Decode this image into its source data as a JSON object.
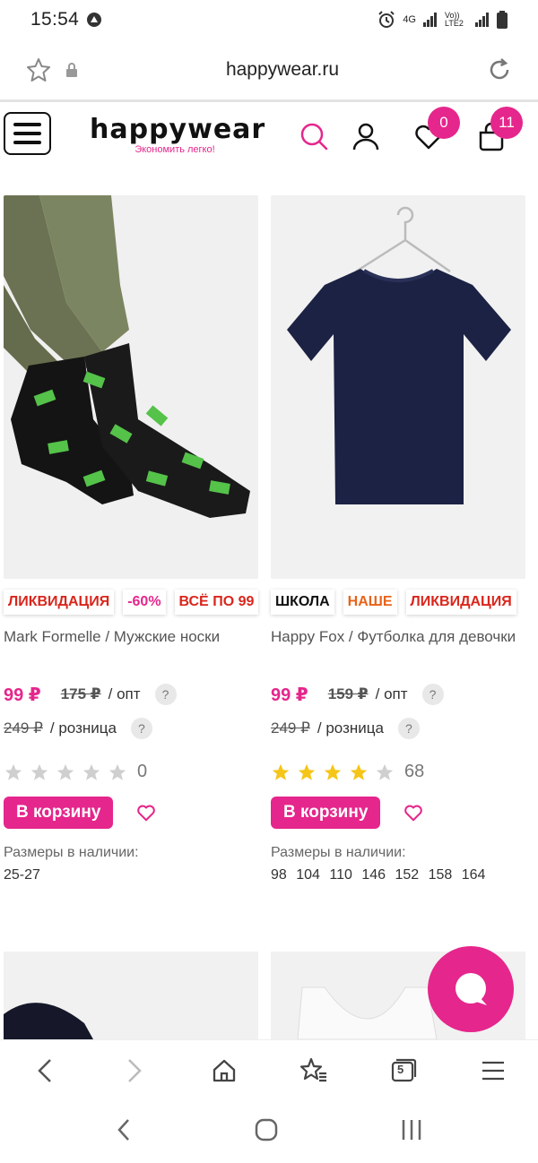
{
  "status_bar": {
    "time": "15:54",
    "network": "4G",
    "volte": "Vo)) LTE2"
  },
  "browser": {
    "url": "happywear.ru",
    "tab_count": "5"
  },
  "site": {
    "logo": "happywear",
    "tagline": "Экономить легко!",
    "favorites_count": "0",
    "cart_count": "11",
    "accent_color": "#e5268c"
  },
  "products": [
    {
      "tags": [
        {
          "label": "ЛИКВИДАЦИЯ",
          "color": "#d9261c"
        },
        {
          "label": "-60%",
          "color": "#e5268c"
        },
        {
          "label": "ВСЁ ПО 99",
          "color": "#d9261c"
        }
      ],
      "title": "Mark Formelle / Мужские носки",
      "price": "99 ₽",
      "old_wholesale": "175 ₽",
      "wholesale_label": "/ опт",
      "retail_price": "249 ₽",
      "retail_label": "/ розница",
      "rating": 0,
      "reviews": "0",
      "cart_label": "В корзину",
      "sizes_label": "Размеры в наличии:",
      "sizes": "25-27"
    },
    {
      "tags": [
        {
          "label": "ШКОЛА",
          "color": "#111111"
        },
        {
          "label": "НАШЕ",
          "color": "#e8631a"
        },
        {
          "label": "ЛИКВИДАЦИЯ",
          "color": "#d9261c"
        }
      ],
      "title": "Happy Fox / Футболка для девочки",
      "price": "99 ₽",
      "old_wholesale": "159 ₽",
      "wholesale_label": "/ опт",
      "retail_price": "249 ₽",
      "retail_label": "/ розница",
      "rating": 4,
      "reviews": "68",
      "cart_label": "В корзину",
      "sizes_label": "Размеры в наличии:",
      "sizes": "98 104 110 146 152 158 164"
    }
  ],
  "help": {
    "question_mark": "?"
  }
}
